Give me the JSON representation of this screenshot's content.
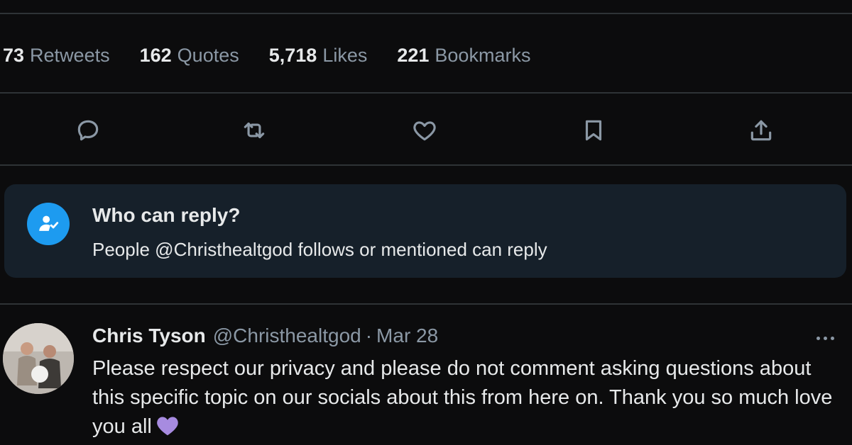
{
  "stats": [
    {
      "count": "73",
      "label": "Retweets"
    },
    {
      "count": "162",
      "label": "Quotes"
    },
    {
      "count": "5,718",
      "label": "Likes"
    },
    {
      "count": "221",
      "label": "Bookmarks"
    }
  ],
  "actions": [
    "reply-icon",
    "retweet-icon",
    "like-icon",
    "bookmark-icon",
    "share-icon"
  ],
  "reply_settings": {
    "title": "Who can reply?",
    "description": "People @Christhealtgod follows or mentioned can reply"
  },
  "tweet": {
    "name": "Chris Tyson",
    "handle": "@Christhealtgod",
    "separator": "·",
    "date": "Mar 28",
    "text": "Please respect our privacy and please do not comment asking questions about this specific topic on our socials about this from here on. Thank you so much love you all",
    "emoji": "purple-heart"
  },
  "colors": {
    "background": "#0c0c0d",
    "divider": "#2f3336",
    "secondary_text": "#8b98a5",
    "accent": "#1d9bf0",
    "reply_box": "#16202a",
    "emoji": "#a78be0"
  }
}
